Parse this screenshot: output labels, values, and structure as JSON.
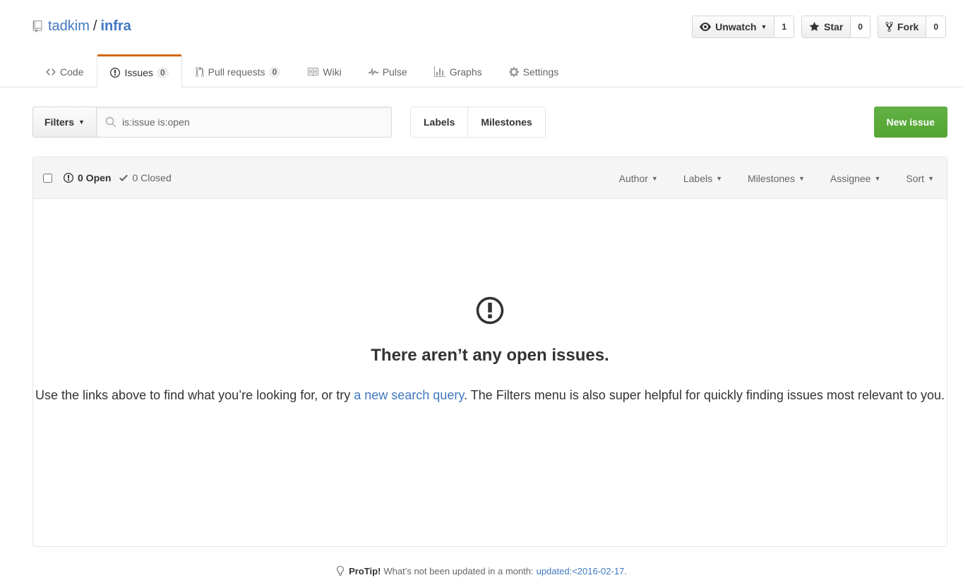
{
  "repo": {
    "owner": "tadkim",
    "separator": "/",
    "name": "infra"
  },
  "actions": {
    "watch": {
      "label": "Unwatch",
      "count": "1"
    },
    "star": {
      "label": "Star",
      "count": "0"
    },
    "fork": {
      "label": "Fork",
      "count": "0"
    }
  },
  "nav": {
    "code": "Code",
    "issues": "Issues",
    "issues_count": "0",
    "pulls": "Pull requests",
    "pulls_count": "0",
    "wiki": "Wiki",
    "pulse": "Pulse",
    "graphs": "Graphs",
    "settings": "Settings"
  },
  "subnav": {
    "filters": "Filters",
    "search_value": "is:issue is:open",
    "labels": "Labels",
    "milestones": "Milestones",
    "new_issue": "New issue"
  },
  "table": {
    "open": "0 Open",
    "closed": "0 Closed",
    "filters": [
      "Author",
      "Labels",
      "Milestones",
      "Assignee",
      "Sort"
    ]
  },
  "blankslate": {
    "title": "There aren’t any open issues.",
    "text_before": "Use the links above to find what you’re looking for, or try ",
    "link": "a new search query",
    "text_after": ". The Filters menu is also super helpful for quickly finding issues most relevant to you."
  },
  "protip": {
    "label": "ProTip!",
    "text": "What’s not been updated in a month:",
    "link": "updated:<2016-02-17",
    "end": "."
  },
  "colors": {
    "link": "#4078c0",
    "primary": "#55a532",
    "nav_accent": "#d26911"
  }
}
